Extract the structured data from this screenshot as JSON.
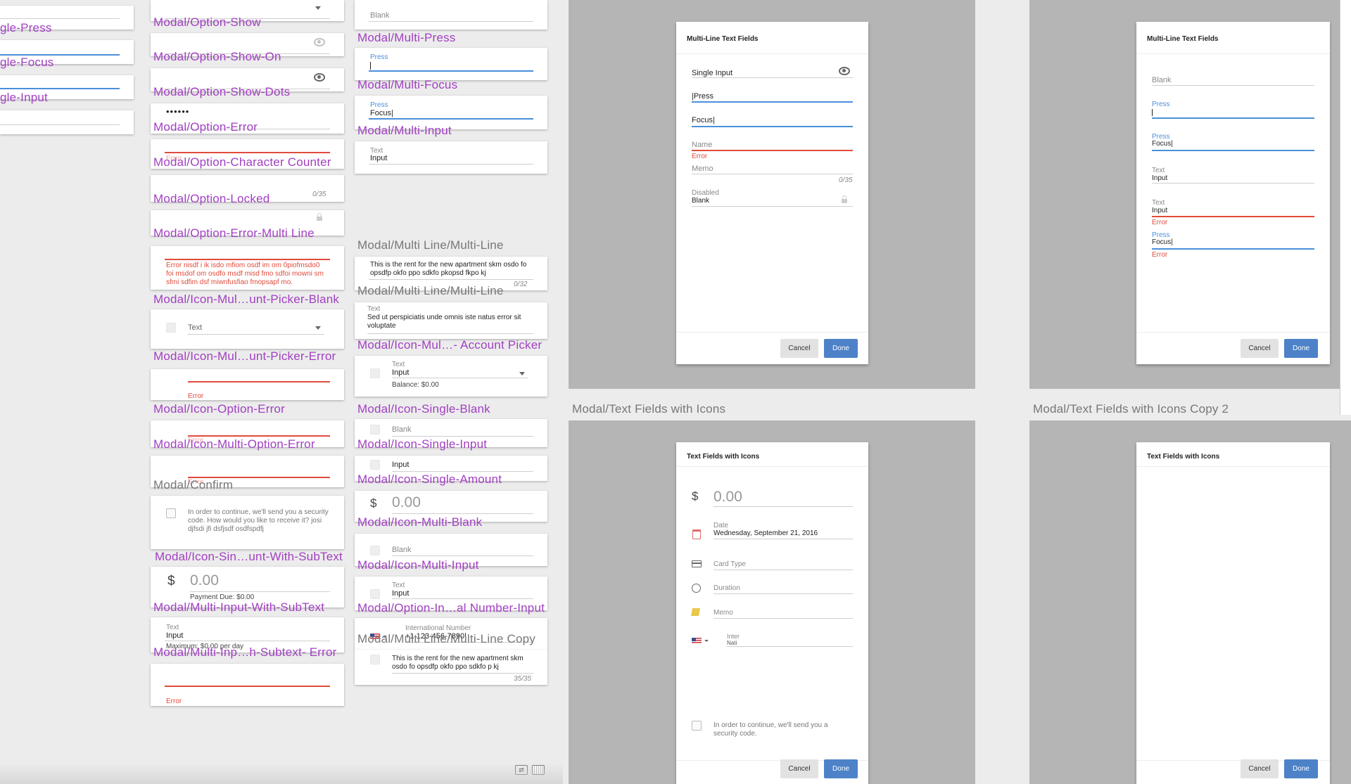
{
  "col1_labels": [
    "gle-Press",
    "gle-Focus",
    "gle-Input"
  ],
  "col2": {
    "labels": {
      "option_show": "Modal/Option-Show",
      "option_show_on": "Modal/Option-Show-On",
      "option_show_dots": "Modal/Option-Show-Dots",
      "option_error": "Modal/Option-Error",
      "option_char_counter": "Modal/Option-Character Counter",
      "option_locked": "Modal/Option-Locked",
      "option_error_multiline": "Modal/Option-Error-Multi Line",
      "icon_mul_picker_blank": "Modal/Icon-Mul…unt-Picker-Blank",
      "icon_mul_picker_error": "Modal/Icon-Mul…unt-Picker-Error",
      "icon_option_error": "Modal/Icon-Option-Error",
      "icon_multi_option_error": "Modal/Icon-Multi-Option-Error",
      "confirm": "Modal/Confirm",
      "icon_sin_subtext": "Modal/Icon-Sin…unt-With-SubText",
      "multi_input_subtext": "Modal/Multi-Input-With-SubText",
      "multi_inp_subtext_error": "Modal/Multi-Inp…h-Subtext- Error"
    },
    "dots": "••••••",
    "counter_035": "0/35",
    "error_multiline": "Error nisdf i ik isdo mfiom osdf im om 0piofmsdo0 foi msdof om osdfo msdf misd fmo sdfoi mowni sm sfmi sdfim dsf miwnfusfiao fmopsapf mo.",
    "picker_text": "Text",
    "error_word": "Error",
    "error_faint": "Error",
    "confirm_text": "In order to continue, we'll send you a security code. How would you like to receive it? josi djfsdi jfi dsfjsdf osdfspdfj",
    "dollar": "$",
    "amount": "0.00",
    "payment_due": "Payment Due: $0.00",
    "sub_text_label": "Text",
    "sub_input": "Input",
    "max_per_day": "Maximum: $0.00 per day"
  },
  "col3": {
    "labels": {
      "multi_press": "Modal/Multi-Press",
      "multi_focus": "Modal/Multi-Focus",
      "multi_input": "Modal/Multi-Input",
      "multiline_a": "Modal/Multi Line/Multi-Line",
      "multiline_b": "Modal/Multi Line/Multi-Line",
      "icon_mul_account_picker": "Modal/Icon-Mul…- Account Picker",
      "icon_single_blank": "Modal/Icon-Single-Blank",
      "icon_single_input": "Modal/Icon-Single-Input",
      "icon_single_amount": "Modal/Icon-Single-Amount",
      "icon_multi_blank": "Modal/Icon-Multi-Blank",
      "icon_multi_input": "Modal/Icon-Multi-Input",
      "option_intl_number": "Modal/Option-In…al Number-Input",
      "multiline_copy": "Modal/Multi Line/Multi-Line Copy"
    },
    "blank": "Blank",
    "press": "Press",
    "focus": "Focus|",
    "text": "Text",
    "input": "Input",
    "rent_text": "This is the rent for the new apartment skm osdo fo opsdfp okfo ppo sdkfo pkopsd fkpo kj",
    "counter_032": "0/32",
    "lorem": "Sed ut perspiciatis unde omnis iste natus error sit voluptate",
    "balance": "Balance: $0.00",
    "dollar": "$",
    "amount": "0.00",
    "intl_label": "International Number",
    "intl_value": "+1 123-456-7890|",
    "rent_text2": "This is the rent for the new apartment skm osdo fo opsdfp okfo ppo sdkfo p kj",
    "counter_3535": "35/35"
  },
  "artboards": {
    "tl": {
      "title": "Multi-Line Text Fields",
      "single_input": "Single Input",
      "press": "|Press",
      "focus": "Focus|",
      "name": "Name",
      "error": "Error",
      "memo": "Memo",
      "counter": "0/35",
      "disabled_label": "Disabled",
      "disabled_value": "Blank",
      "cancel": "Cancel",
      "done": "Done"
    },
    "tr": {
      "title": "Multi-Line Text Fields",
      "blank": "Blank",
      "press": "Press",
      "press2": "Press",
      "focus": "Focus|",
      "text": "Text",
      "input": "Input",
      "text2": "Text",
      "input2": "Input",
      "error": "Error",
      "press3": "Press",
      "focus2": "Focus|",
      "error2": "Error",
      "cancel": "Cancel",
      "done": "Done"
    },
    "bl": {
      "heading": "Modal/Text Fields with Icons",
      "title": "Text Fields with Icons",
      "dollar": "$",
      "amount": "0.00",
      "date_label": "Date",
      "date_value": "Wednesday, September 21, 2016",
      "card_type": "Card Type",
      "duration": "Duration",
      "memo": "Memo",
      "inter": "Inter",
      "inter_sub": "Nati",
      "confirm": "In order to continue, we'll send you a security code.",
      "cancel": "Cancel",
      "done": "Done"
    },
    "br": {
      "heading": "Modal/Text Fields with Icons Copy 2",
      "title": "Text Fields with Icons",
      "cancel": "Cancel",
      "done": "Done"
    }
  },
  "colors": {
    "label": "#a13fc2",
    "focus_blue": "#4a8fdc",
    "error_red": "#e04b3c",
    "done_btn": "#4d82c9",
    "artboard": "#b5b5b5"
  },
  "icons": [
    "caret-down-icon",
    "eye-icon",
    "lock-icon",
    "calendar-icon",
    "card-icon",
    "clock-icon",
    "pencil-icon",
    "us-flag-icon",
    "checkbox-icon",
    "swap-icon",
    "keyboard-icon"
  ]
}
